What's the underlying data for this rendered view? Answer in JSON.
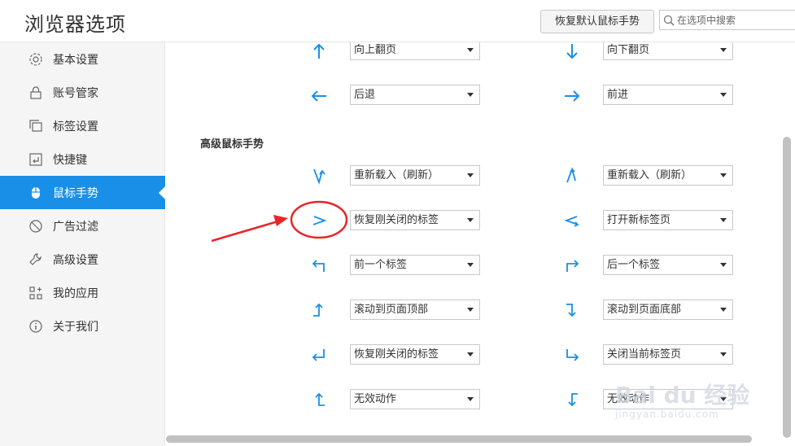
{
  "header": {
    "title": "浏览器选项",
    "restore_button": "恢复默认鼠标手势",
    "search_placeholder": "在选项中搜索"
  },
  "sidebar": {
    "items": [
      {
        "label": "基本设置",
        "icon": "gear-icon"
      },
      {
        "label": "账号管家",
        "icon": "lock-icon"
      },
      {
        "label": "标签设置",
        "icon": "tabs-icon"
      },
      {
        "label": "快捷键",
        "icon": "keyboard-icon"
      },
      {
        "label": "鼠标手势",
        "icon": "mouse-icon",
        "active": true
      },
      {
        "label": "广告过滤",
        "icon": "block-icon"
      },
      {
        "label": "高级设置",
        "icon": "wrench-icon"
      },
      {
        "label": "我的应用",
        "icon": "apps-icon"
      },
      {
        "label": "关于我们",
        "icon": "info-icon"
      }
    ]
  },
  "content": {
    "section_title": "高级鼠标手势",
    "basic_rows": [
      {
        "left": {
          "icon": "arrow-up-icon",
          "value": "向上翻页"
        },
        "right": {
          "icon": "arrow-down-icon",
          "value": "向下翻页"
        }
      },
      {
        "left": {
          "icon": "arrow-left-icon",
          "value": "后退"
        },
        "right": {
          "icon": "arrow-right-icon",
          "value": "前进"
        }
      }
    ],
    "advanced_rows": [
      {
        "left": {
          "icon": "gesture-down-up-icon",
          "value": "重新载入（刷新）"
        },
        "right": {
          "icon": "gesture-up-down-icon",
          "value": "重新载入（刷新）"
        }
      },
      {
        "left": {
          "icon": "gesture-right-left-icon",
          "value": "恢复刚关闭的标签"
        },
        "right": {
          "icon": "gesture-left-right-icon",
          "value": "打开新标签页"
        }
      },
      {
        "left": {
          "icon": "gesture-up-left-icon",
          "value": "前一个标签"
        },
        "right": {
          "icon": "gesture-up-right-icon",
          "value": "后一个标签"
        }
      },
      {
        "left": {
          "icon": "gesture-right-up-icon",
          "value": "滚动到页面顶部"
        },
        "right": {
          "icon": "gesture-right-down-icon",
          "value": "滚动到页面底部"
        }
      },
      {
        "left": {
          "icon": "gesture-up-left-enter-icon",
          "value": "恢复刚关闭的标签"
        },
        "right": {
          "icon": "gesture-down-right-icon",
          "value": "关闭当前标签页"
        }
      },
      {
        "left": {
          "icon": "gesture-left-up-icon",
          "value": "无效动作"
        },
        "right": {
          "icon": "gesture-left-down-icon",
          "value": "无效动作"
        }
      }
    ]
  },
  "colors": {
    "accent": "#1a8fe8",
    "annotation": "#e8262a"
  },
  "watermark": {
    "brand": "Bai du 经验",
    "url": "jingyan.baidu.com"
  }
}
